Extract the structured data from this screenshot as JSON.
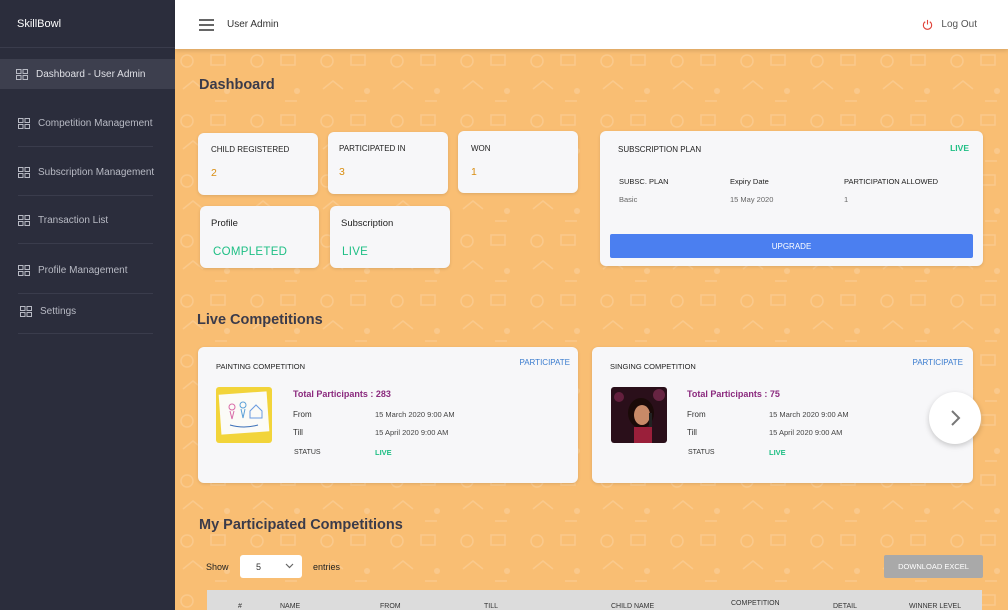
{
  "app": {
    "brand": "SkillBowl"
  },
  "sidebar": {
    "items": [
      {
        "label": "Dashboard - User Admin",
        "active": true
      },
      {
        "label": "Competition Management"
      },
      {
        "label": "Subscription Management"
      },
      {
        "label": "Transaction List"
      },
      {
        "label": "Profile Management"
      },
      {
        "label": "Settings"
      }
    ]
  },
  "topbar": {
    "user": "User Admin",
    "logout": "Log Out"
  },
  "dashboard": {
    "title": "Dashboard",
    "stats": [
      {
        "label": "CHILD REGISTERED",
        "value": "2"
      },
      {
        "label": "PARTICIPATED IN",
        "value": "3"
      },
      {
        "label": "WON",
        "value": "1"
      }
    ],
    "profile": {
      "label": "Profile",
      "value": "COMPLETED"
    },
    "subscription": {
      "label": "Subscription",
      "value": "LIVE"
    },
    "plan": {
      "title": "SUBSCRIPTION PLAN",
      "status": "LIVE",
      "headers": [
        "SUBSC. PLAN",
        "Expiry Date",
        "PARTICIPATION ALLOWED"
      ],
      "values": [
        "Basic",
        "15 May 2020",
        "1"
      ],
      "upgrade": "UPGRADE"
    }
  },
  "live": {
    "title": "Live Competitions",
    "competitions": [
      {
        "title": "PAINTING COMPETITION",
        "action": "PARTICIPATE",
        "total": "Total Participants : 283",
        "from_label": "From",
        "from": "15 March 2020 9:00 AM",
        "till_label": "Till",
        "till": "15 April 2020 9:00 AM",
        "status_label": "STATUS",
        "status": "LIVE",
        "image_icon": "family-drawing-image"
      },
      {
        "title": "SINGING COMPETITION",
        "action": "PARTICIPATE",
        "total": "Total Participants : 75",
        "from_label": "From",
        "from": "15 March 2020 9:00 AM",
        "till_label": "Till",
        "till": "15 April 2020 9:00 AM",
        "status_label": "STATUS",
        "status": "LIVE",
        "image_icon": "singer-photo-image"
      }
    ]
  },
  "participated": {
    "title": "My Participated Competitions",
    "show": "Show",
    "entries": "entries",
    "page_size": "5",
    "download": "DOWNLOAD EXCEL",
    "columns": [
      "#",
      "NAME",
      "FROM",
      "TILL",
      "CHILD NAME",
      "COMPETITION",
      "DETAIL",
      "WINNER LEVEL"
    ]
  },
  "colors": {
    "sidebar": "#2b2d3c",
    "background": "#f9be73",
    "accent": "#4b7ff0",
    "live": "#1fbf85",
    "count": "#d98e12",
    "participants": "#8b2a7e"
  }
}
